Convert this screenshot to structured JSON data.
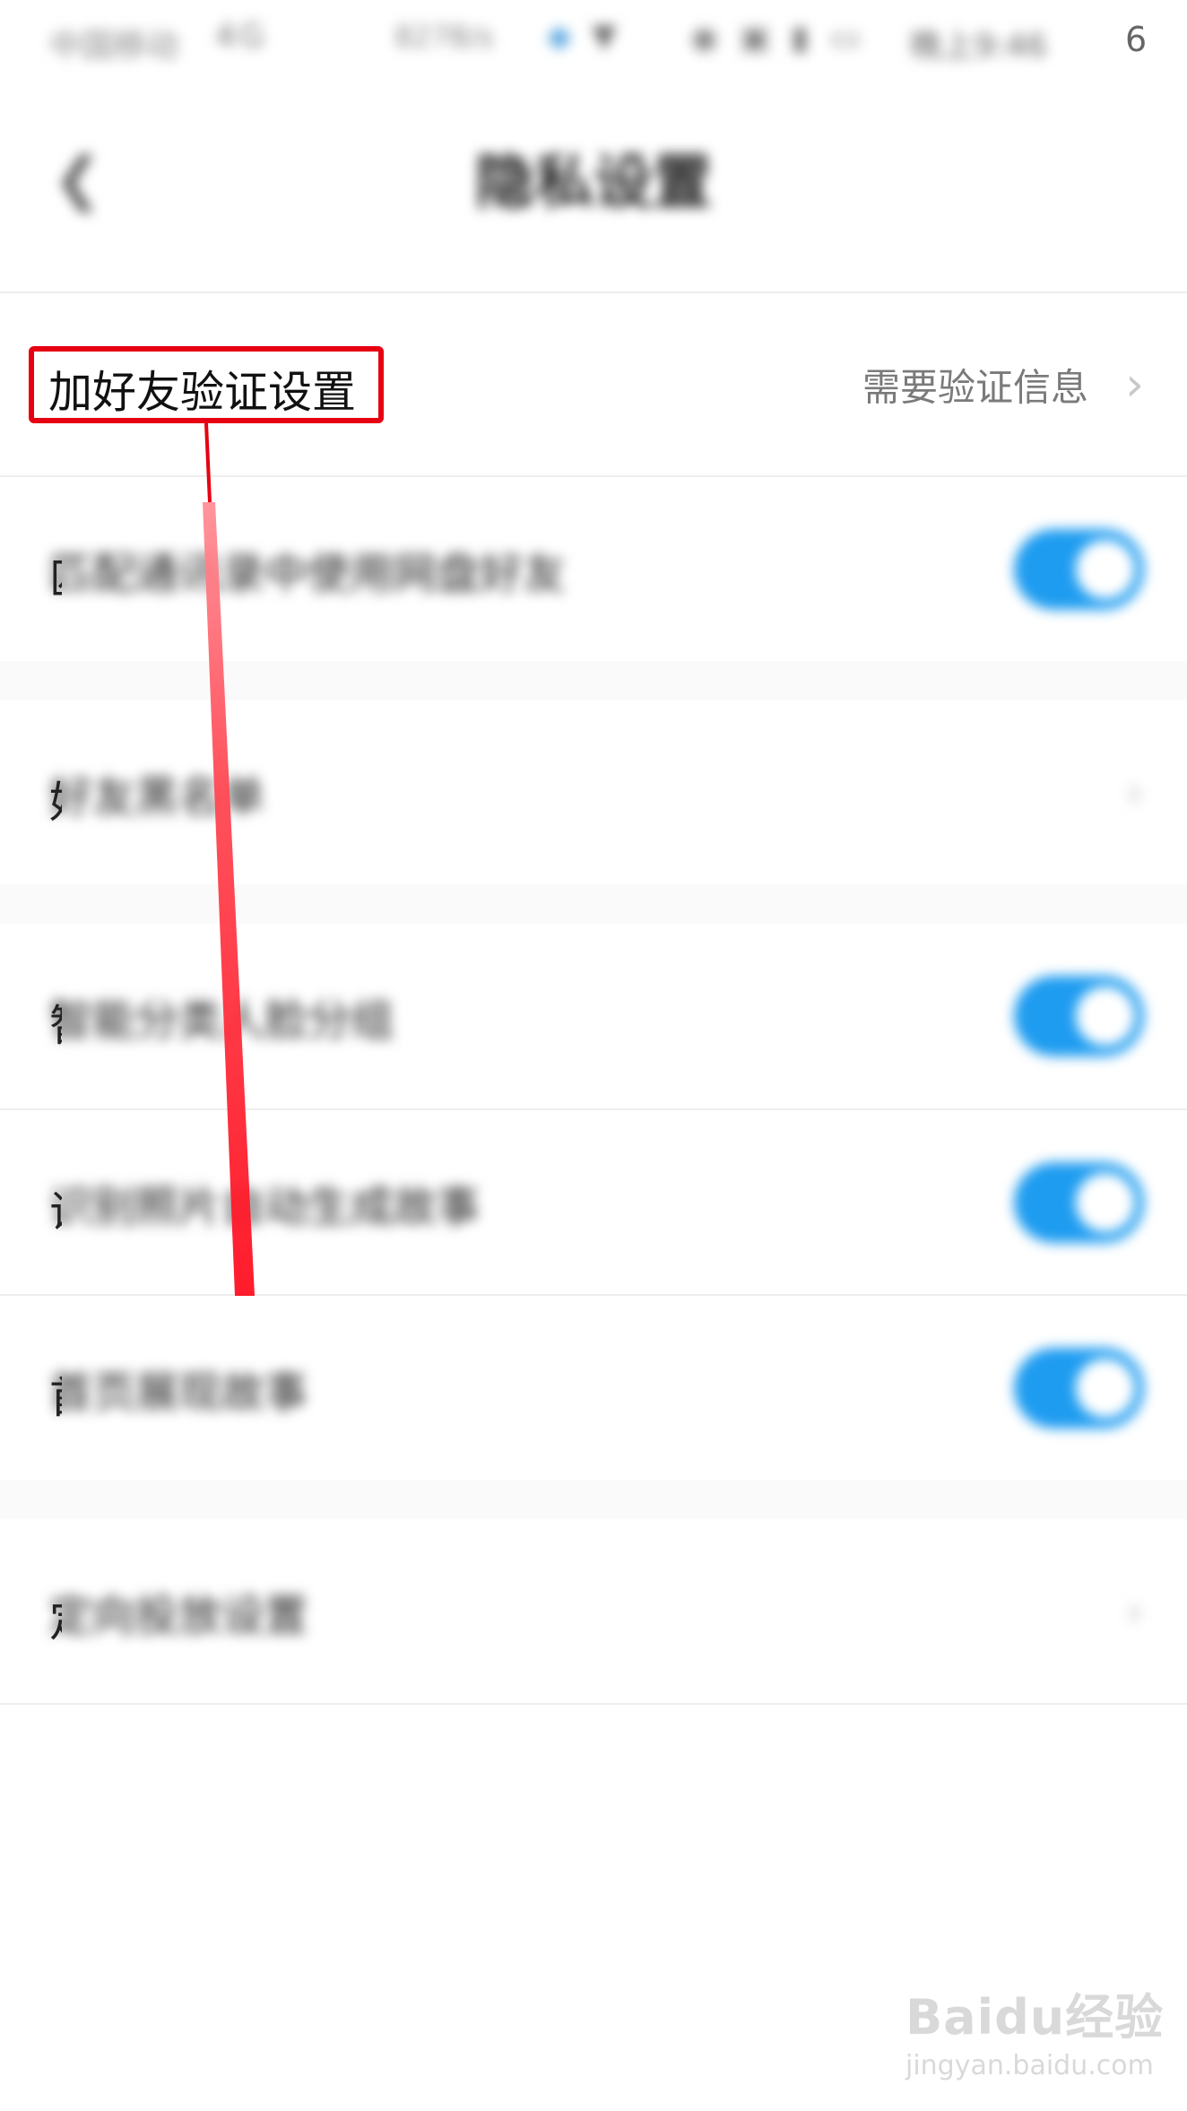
{
  "status_bar": {
    "carrier": "中国移动",
    "signal": "4G",
    "speed": "827B/s",
    "time": "晚上9:46",
    "clear_digit": "6"
  },
  "header": {
    "title": "隐私设置",
    "back_icon": "chevron-left-icon"
  },
  "items": [
    {
      "label": "加好友验证设置",
      "value": "需要验证信息",
      "control": "chevron"
    },
    {
      "label": "匹配通讯录中使用网盘好友",
      "control": "toggle",
      "on": true
    },
    {
      "label": "好友黑名单",
      "control": "chevron"
    },
    {
      "label": "智能分类人脸分组",
      "control": "toggle",
      "on": true
    },
    {
      "label": "识别照片自动生成故事",
      "control": "toggle",
      "on": true
    },
    {
      "label": "首页展现故事",
      "control": "toggle",
      "on": true
    },
    {
      "label": "定向投放设置",
      "control": "chevron"
    }
  ],
  "highlight": {
    "label": "加好友验证设置",
    "color": "#e60012"
  },
  "colors": {
    "toggle_on": "#1e9cf0",
    "annotation": "#e60012"
  },
  "watermark": {
    "brand": "Baidu经验",
    "url": "jingyan.baidu.com"
  }
}
